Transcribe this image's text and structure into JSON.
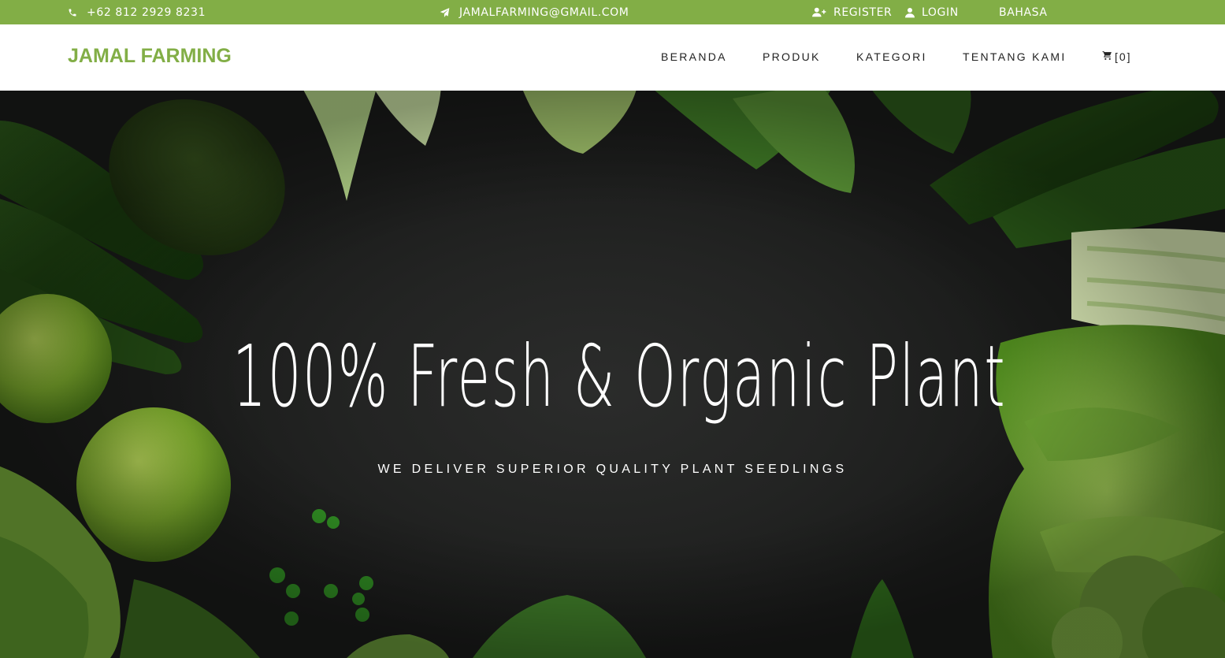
{
  "topbar": {
    "phone": "+62 812 2929 8231",
    "email": "JAMALFARMING@GMAIL.COM",
    "register": "REGISTER",
    "login": "LOGIN",
    "language": "BAHASA"
  },
  "navbar": {
    "brand": "JAMAL FARMING",
    "links": [
      "BERANDA",
      "PRODUK",
      "KATEGORI",
      "TENTANG KAMI"
    ],
    "cart": "[0]"
  },
  "hero": {
    "title": "100% Fresh & Organic Plant",
    "subtitle": "WE DELIVER SUPERIOR QUALITY PLANT SEEDLINGS"
  },
  "colors": {
    "accent": "#82ae46",
    "navbar_bg": "#ffffff",
    "hero_bg": "#232423"
  },
  "icons": {
    "phone": "phone-icon",
    "email": "paper-plane-icon",
    "register": "user-plus-icon",
    "login": "user-icon",
    "cart": "cart-icon"
  }
}
